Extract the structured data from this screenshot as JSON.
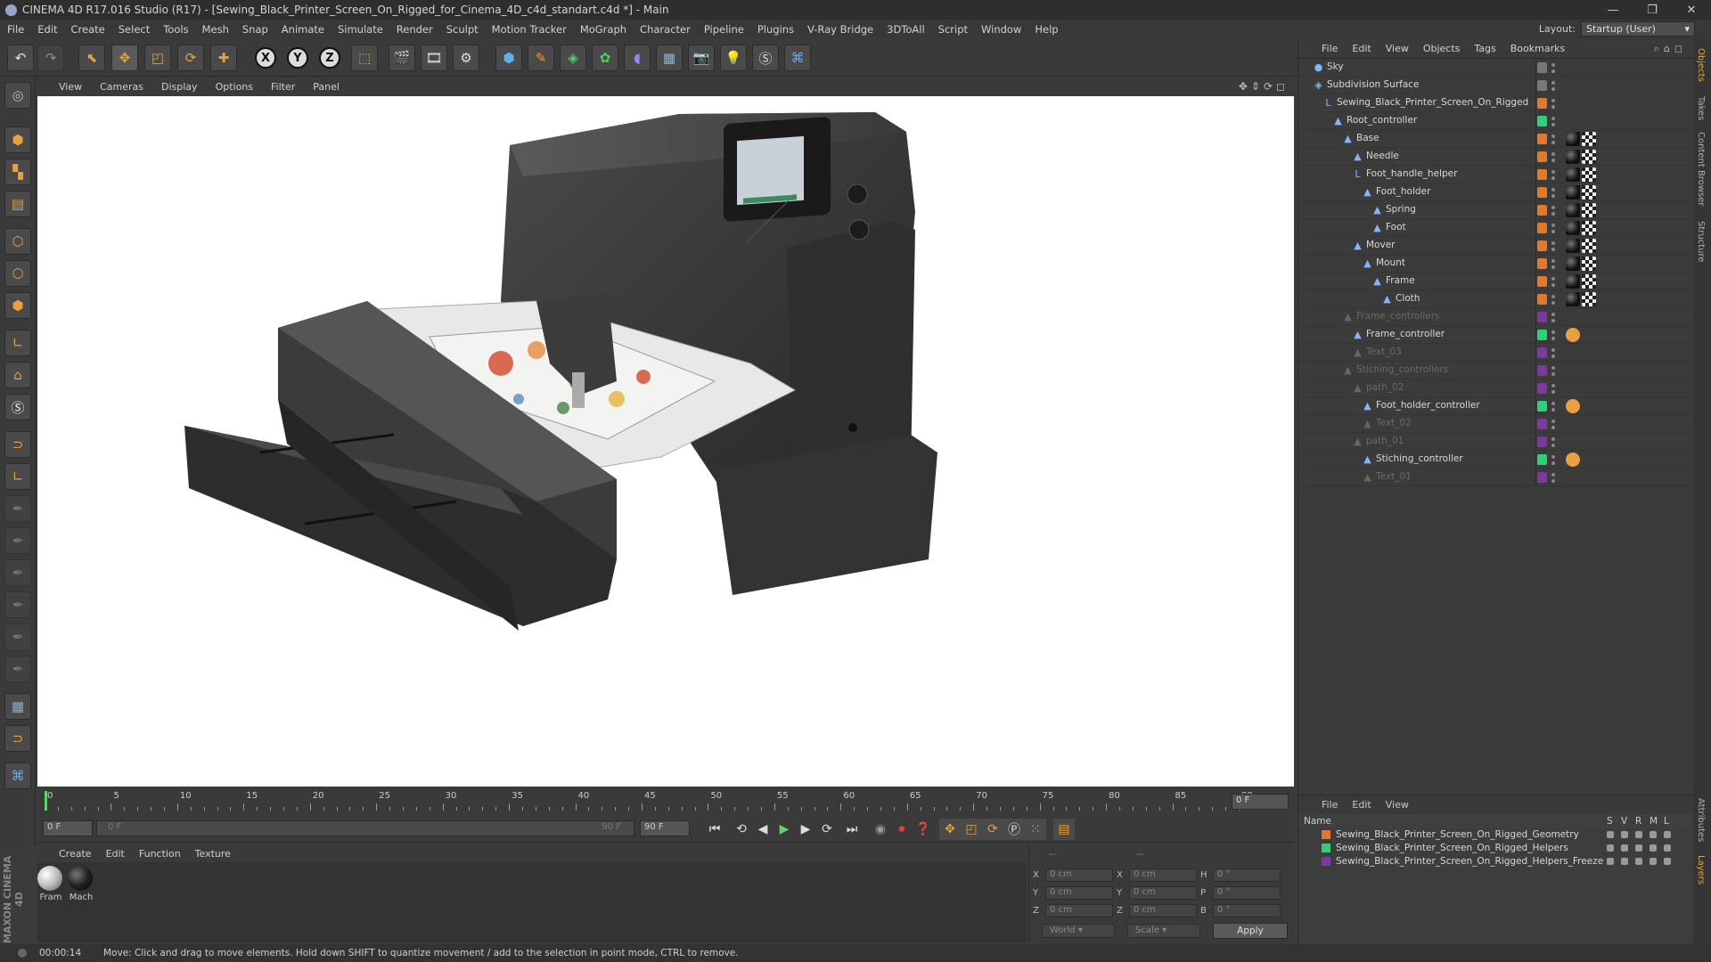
{
  "title": "CINEMA 4D R17.016 Studio (R17) - [Sewing_Black_Printer_Screen_On_Rigged_for_Cinema_4D_c4d_standart.c4d *] - Main",
  "window_buttons": [
    "—",
    "❐",
    "✕"
  ],
  "menu": [
    "File",
    "Edit",
    "Create",
    "Select",
    "Tools",
    "Mesh",
    "Snap",
    "Animate",
    "Simulate",
    "Render",
    "Sculpt",
    "Motion Tracker",
    "MoGraph",
    "Character",
    "Pipeline",
    "Plugins",
    "V-Ray Bridge",
    "3DToAll",
    "Script",
    "Window",
    "Help"
  ],
  "layout": {
    "label": "Layout:",
    "value": "Startup (User)"
  },
  "viewport_menu": [
    "View",
    "Cameras",
    "Display",
    "Options",
    "Filter",
    "Panel"
  ],
  "viewport_nav": "✥⇕⟳◻",
  "timeline": {
    "ticks": [
      "0",
      "5",
      "10",
      "15",
      "20",
      "25",
      "30",
      "35",
      "40",
      "45",
      "50",
      "55",
      "60",
      "65",
      "70",
      "75",
      "80",
      "85",
      "90"
    ],
    "frame_field": "0 F"
  },
  "playback": {
    "start": "0 F",
    "range_start": "0 F",
    "range_end": "90 F",
    "end": "90 F",
    "progress": 0.0
  },
  "materials": {
    "menu": [
      "Create",
      "Edit",
      "Function",
      "Texture"
    ],
    "items": [
      "Fram",
      "Mach"
    ]
  },
  "coordinates": {
    "rows": [
      {
        "a": "X",
        "av": "0 cm",
        "b": "X",
        "bv": "0 cm",
        "c": "H",
        "cv": "0 °"
      },
      {
        "a": "Y",
        "av": "0 cm",
        "b": "Y",
        "bv": "0 cm",
        "c": "P",
        "cv": "0 °"
      },
      {
        "a": "Z",
        "av": "0 cm",
        "b": "Z",
        "bv": "0 cm",
        "c": "B",
        "cv": "0 °"
      }
    ],
    "world": "World",
    "scale": "Scale",
    "apply": "Apply",
    "header_a": "--",
    "header_b": "--"
  },
  "status": {
    "time": "00:00:14",
    "message": "Move: Click and drag to move elements. Hold down SHIFT to quantize movement / add to the selection in point mode, CTRL to remove."
  },
  "object_manager": {
    "menu": [
      "File",
      "Edit",
      "View",
      "Objects",
      "Tags",
      "Bookmarks"
    ],
    "objects": [
      {
        "name": "Sky",
        "indent": 0,
        "color": "#777777",
        "dim": false,
        "icon": "●"
      },
      {
        "name": "Subdivision Surface",
        "indent": 0,
        "color": "#777777",
        "dim": false,
        "icon": "◈"
      },
      {
        "name": "Sewing_Black_Printer_Screen_On_Rigged",
        "indent": 1,
        "color": "#e07a2a",
        "dim": false,
        "icon": "L"
      },
      {
        "name": "Root_controller",
        "indent": 2,
        "color": "#2fd07a",
        "dim": false,
        "icon": "▲"
      },
      {
        "name": "Base",
        "indent": 3,
        "color": "#e07a2a",
        "dim": false,
        "icon": "▲"
      },
      {
        "name": "Needle",
        "indent": 4,
        "color": "#e07a2a",
        "dim": false,
        "icon": "▲"
      },
      {
        "name": "Foot_handle_helper",
        "indent": 4,
        "color": "#e07a2a",
        "dim": false,
        "icon": "L"
      },
      {
        "name": "Foot_holder",
        "indent": 5,
        "color": "#e07a2a",
        "dim": false,
        "icon": "▲"
      },
      {
        "name": "Spring",
        "indent": 6,
        "color": "#e07a2a",
        "dim": false,
        "icon": "▲"
      },
      {
        "name": "Foot",
        "indent": 6,
        "color": "#e07a2a",
        "dim": false,
        "icon": "▲"
      },
      {
        "name": "Mover",
        "indent": 4,
        "color": "#e07a2a",
        "dim": false,
        "icon": "▲"
      },
      {
        "name": "Mount",
        "indent": 5,
        "color": "#e07a2a",
        "dim": false,
        "icon": "▲"
      },
      {
        "name": "Frame",
        "indent": 6,
        "color": "#e07a2a",
        "dim": false,
        "icon": "▲"
      },
      {
        "name": "Cloth",
        "indent": 7,
        "color": "#e07a2a",
        "dim": false,
        "icon": "▲"
      },
      {
        "name": "Frame_controllers",
        "indent": 3,
        "color": "#7a3aa0",
        "dim": true,
        "icon": "▲"
      },
      {
        "name": "Frame_controller",
        "indent": 4,
        "color": "#2fd07a",
        "dim": false,
        "icon": "▲"
      },
      {
        "name": "Text_03",
        "indent": 4,
        "color": "#7a3aa0",
        "dim": true,
        "icon": "▲"
      },
      {
        "name": "Stiching_controllers",
        "indent": 3,
        "color": "#7a3aa0",
        "dim": true,
        "icon": "▲"
      },
      {
        "name": "path_02",
        "indent": 4,
        "color": "#7a3aa0",
        "dim": true,
        "icon": "▲"
      },
      {
        "name": "Foot_holder_controller",
        "indent": 5,
        "color": "#2fd07a",
        "dim": false,
        "icon": "▲"
      },
      {
        "name": "Text_02",
        "indent": 5,
        "color": "#7a3aa0",
        "dim": true,
        "icon": "▲"
      },
      {
        "name": "path_01",
        "indent": 4,
        "color": "#7a3aa0",
        "dim": true,
        "icon": "▲"
      },
      {
        "name": "Stiching_controller",
        "indent": 5,
        "color": "#2fd07a",
        "dim": false,
        "icon": "▲"
      },
      {
        "name": "Text_01",
        "indent": 5,
        "color": "#7a3aa0",
        "dim": true,
        "icon": "▲"
      }
    ]
  },
  "layer_manager": {
    "menu": [
      "File",
      "Edit",
      "View"
    ],
    "columns": [
      "Name",
      "S",
      "V",
      "R",
      "M",
      "L"
    ],
    "layers": [
      {
        "name": "Sewing_Black_Printer_Screen_On_Rigged_Geometry",
        "color": "#e07a2a"
      },
      {
        "name": "Sewing_Black_Printer_Screen_On_Rigged_Helpers",
        "color": "#2fd07a"
      },
      {
        "name": "Sewing_Black_Printer_Screen_On_Rigged_Helpers_Freeze",
        "color": "#7a3aa0"
      }
    ]
  },
  "right_tabs": [
    "Objects",
    "Takes",
    "Content Browser",
    "Structure",
    "Attributes",
    "Layers"
  ],
  "brand": "MAXON CINEMA 4D"
}
